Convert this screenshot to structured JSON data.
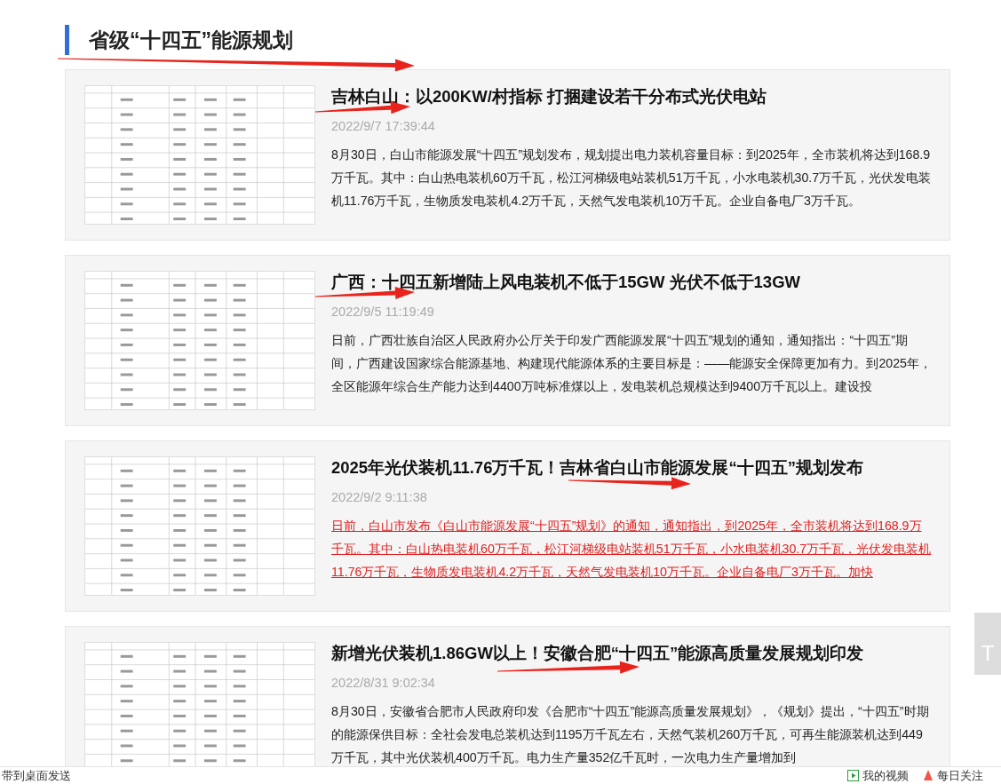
{
  "section_title": "省级“十四五”能源规划",
  "articles": [
    {
      "title": "吉林白山：以200KW/村指标 打捆建设若干分布式光伏电站",
      "date": "2022/9/7 17:39:44",
      "summary": "8月30日，白山市能源发展“十四五”规划发布，规划提出电力装机容量目标：到2025年，全市装机将达到168.9万千瓦。其中：白山热电装机60万千瓦，松江河梯级电站装机51万千瓦，小水电装机30.7万千瓦，光伏发电装机11.76万千瓦，生物质发电装机4.2万千瓦，天然气发电装机10万千瓦。企业自备电厂3万千瓦。",
      "hovered": false
    },
    {
      "title": "广西：十四五新增陆上风电装机不低于15GW 光伏不低于13GW",
      "date": "2022/9/5 11:19:49",
      "summary": "日前，广西壮族自治区人民政府办公厅关于印发广西能源发展“十四五”规划的通知，通知指出：“十四五”期间，广西建设国家综合能源基地、构建现代能源体系的主要目标是：——能源安全保障更加有力。到2025年，全区能源年综合生产能力达到4400万吨标准煤以上，发电装机总规模达到9400万千瓦以上。建设投",
      "hovered": false
    },
    {
      "title": "2025年光伏装机11.76万千瓦！吉林省白山市能源发展“十四五”规划发布",
      "date": "2022/9/2 9:11:38",
      "summary": "日前，白山市发布《白山市能源发展“十四五”规划》的通知，通知指出，到2025年，全市装机将达到168.9万千瓦。其中：白山热电装机60万千瓦，松江河梯级电站装机51万千瓦，小水电装机30.7万千瓦，光伏发电装机11.76万千瓦，生物质发电装机4.2万千瓦，天然气发电装机10万千瓦。企业自备电厂3万千瓦。加快",
      "hovered": true
    },
    {
      "title": "新增光伏装机1.86GW以上！安徽合肥“十四五”能源高质量发展规划印发",
      "date": "2022/8/31 9:02:34",
      "summary": "8月30日，安徽省合肥市人民政府印发《合肥市“十四五”能源高质量发展规划》，《规划》提出，“十四五”时期的能源保供目标：全社会发电总装机达到1195万千瓦左右，天然气装机260万千瓦，可再生能源装机达到449万千瓦，其中光伏装机400万千瓦。电力生产量352亿千瓦时，一次电力生产量增加到",
      "hovered": false
    }
  ],
  "back_to_top": "T",
  "bottom_bar": {
    "left_text": "带到桌面发送",
    "links": [
      {
        "kind": "video",
        "label": "我的视频"
      },
      {
        "kind": "follow",
        "label": "每日关注"
      }
    ]
  }
}
